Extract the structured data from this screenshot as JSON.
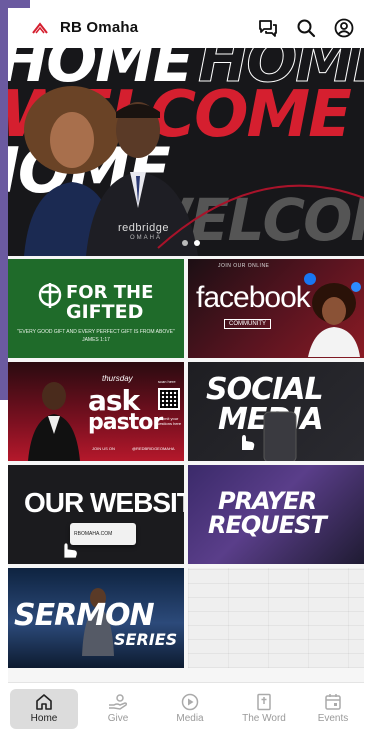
{
  "header": {
    "title": "RB Omaha",
    "icons": [
      "chat-icon",
      "search-icon",
      "account-icon"
    ]
  },
  "hero": {
    "words": [
      "HOME",
      "WELCOME",
      "HOME",
      "WELCOME"
    ],
    "brand": "redbridge",
    "brand_sub": "OMAHA",
    "slides": 2,
    "active_slide": 1
  },
  "tiles": {
    "gifted": {
      "line1": "FOR THE",
      "line2": "GIFTED",
      "verse": "\"EVERY GOOD GIFT AND EVERY PERFECT GIFT IS FROM ABOVE\"",
      "ref": "JAMES 1:17"
    },
    "facebook": {
      "top": "JOIN OUR ONLINE",
      "word": "facebook",
      "sub": "COMMUNITY"
    },
    "ask_pastor": {
      "word1": "ask",
      "word2": "pastor",
      "day": "thursday",
      "scan": "scan here",
      "submit": "submit your questions here",
      "join": "JOIN US ON",
      "handle": "@REDBRIDGEOMAHA"
    },
    "social": {
      "line1": "SOCIAL",
      "line2": "MEDIA"
    },
    "website": {
      "line1": "OUR WEBSITE",
      "url": "RBOMAHA.COM"
    },
    "prayer": {
      "line1": "PRAYER",
      "line2": "REQUEST"
    },
    "sermon": {
      "line1": "SERMON",
      "line2": "SERIES"
    }
  },
  "tabs": [
    {
      "label": "Home",
      "icon": "home-icon"
    },
    {
      "label": "Give",
      "icon": "give-icon"
    },
    {
      "label": "Media",
      "icon": "play-icon"
    },
    {
      "label": "The Word",
      "icon": "bible-icon"
    },
    {
      "label": "Events",
      "icon": "calendar-icon"
    }
  ],
  "colors": {
    "accent_red": "#d51f2f",
    "green": "#1f6b2a",
    "dark": "#17171a"
  }
}
